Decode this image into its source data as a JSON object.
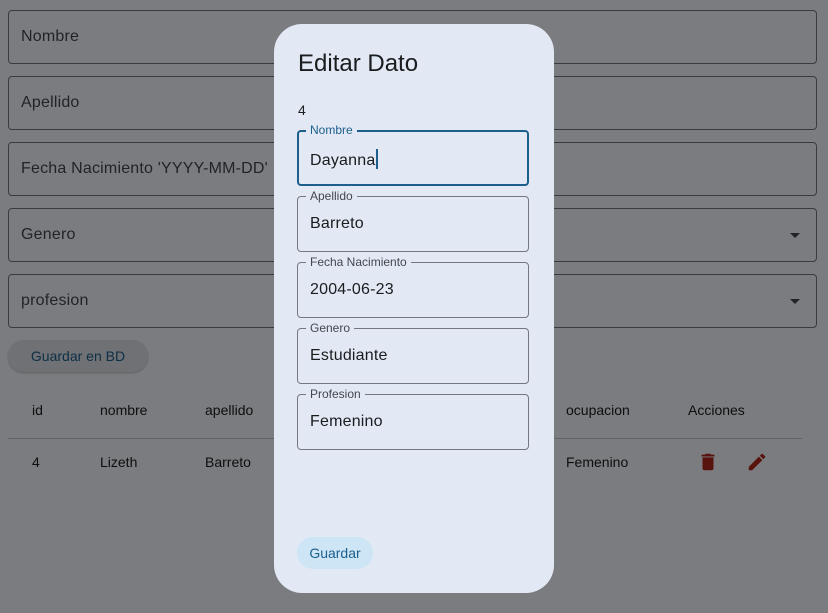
{
  "form": {
    "nombre_placeholder": "Nombre",
    "apellido_placeholder": "Apellido",
    "fecha_placeholder": "Fecha Nacimiento 'YYYY-MM-DD'",
    "genero_placeholder": "Genero",
    "profesion_placeholder": "profesion",
    "save_db_label": "Guardar en BD"
  },
  "table": {
    "headers": [
      "id",
      "nombre",
      "apellido",
      "ocupacion",
      "Acciones"
    ],
    "rows": [
      {
        "id": "4",
        "nombre": "Lizeth",
        "apellido": "Barreto",
        "ocupacion": "Femenino"
      }
    ]
  },
  "dialog": {
    "title": "Editar Dato",
    "record_id": "4",
    "fields": [
      {
        "label": "Nombre",
        "value": "Dayanna"
      },
      {
        "label": "Apellido",
        "value": "Barreto"
      },
      {
        "label": "Fecha Nacimiento",
        "value": "2004-06-23"
      },
      {
        "label": "Genero",
        "value": "Estudiante"
      },
      {
        "label": "Profesion",
        "value": "Femenino"
      }
    ],
    "save_label": "Guardar"
  },
  "colors": {
    "primary": "#1c5f8c",
    "danger": "#b3261e",
    "dialog_surface": "#e2e9f4",
    "scrim": "rgba(0,0,0,0.5)"
  },
  "icons": [
    "delete-icon",
    "edit-icon",
    "dropdown-arrow-icon"
  ]
}
